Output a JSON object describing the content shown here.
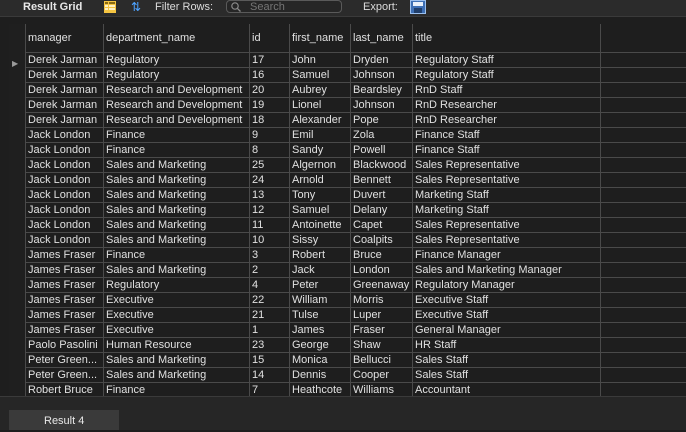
{
  "toolbar": {
    "title": "Result Grid",
    "filter_label": "Filter Rows:",
    "search_placeholder": "Search",
    "export_label": "Export:"
  },
  "grid": {
    "columns": [
      "manager",
      "department_name",
      "id",
      "first_name",
      "last_name",
      "title"
    ],
    "rows": [
      [
        "Derek Jarman",
        "Regulatory",
        "17",
        "John",
        "Dryden",
        "Regulatory Staff"
      ],
      [
        "Derek Jarman",
        "Regulatory",
        "16",
        "Samuel",
        "Johnson",
        "Regulatory Staff"
      ],
      [
        "Derek Jarman",
        "Research and Development",
        "20",
        "Aubrey",
        "Beardsley",
        "RnD Staff"
      ],
      [
        "Derek Jarman",
        "Research and Development",
        "19",
        "Lionel",
        "Johnson",
        "RnD Researcher"
      ],
      [
        "Derek Jarman",
        "Research and Development",
        "18",
        "Alexander",
        "Pope",
        "RnD Researcher"
      ],
      [
        "Jack London",
        "Finance",
        "9",
        "Emil",
        "Zola",
        "Finance Staff"
      ],
      [
        "Jack London",
        "Finance",
        "8",
        "Sandy",
        "Powell",
        "Finance Staff"
      ],
      [
        "Jack London",
        "Sales and Marketing",
        "25",
        "Algernon",
        "Blackwood",
        "Sales Representative"
      ],
      [
        "Jack London",
        "Sales and Marketing",
        "24",
        "Arnold",
        "Bennett",
        "Sales Representative"
      ],
      [
        "Jack London",
        "Sales and Marketing",
        "13",
        "Tony",
        "Duvert",
        "Marketing Staff"
      ],
      [
        "Jack London",
        "Sales and Marketing",
        "12",
        "Samuel",
        "Delany",
        "Marketing Staff"
      ],
      [
        "Jack London",
        "Sales and Marketing",
        "11",
        "Antoinette",
        "Capet",
        "Sales Representative"
      ],
      [
        "Jack London",
        "Sales and Marketing",
        "10",
        "Sissy",
        "Coalpits",
        "Sales Representative"
      ],
      [
        "James Fraser",
        "Finance",
        "3",
        "Robert",
        "Bruce",
        "Finance Manager"
      ],
      [
        "James Fraser",
        "Sales and Marketing",
        "2",
        "Jack",
        "London",
        "Sales and Marketing Manager"
      ],
      [
        "James Fraser",
        "Regulatory",
        "4",
        "Peter",
        "Greenaway",
        "Regulatory Manager"
      ],
      [
        "James Fraser",
        "Executive",
        "22",
        "William",
        "Morris",
        "Executive Staff"
      ],
      [
        "James Fraser",
        "Executive",
        "21",
        "Tulse",
        "Luper",
        "Executive Staff"
      ],
      [
        "James Fraser",
        "Executive",
        "1",
        "James",
        "Fraser",
        "General Manager"
      ],
      [
        "Paolo Pasolini",
        "Human Resource",
        "23",
        "George",
        "Shaw",
        "HR Staff"
      ],
      [
        "Peter Green...",
        "Sales and Marketing",
        "15",
        "Monica",
        "Bellucci",
        "Sales Staff"
      ],
      [
        "Peter Green...",
        "Sales and Marketing",
        "14",
        "Dennis",
        "Cooper",
        "Sales Staff"
      ],
      [
        "Robert Bruce",
        "Finance",
        "7",
        "Heathcote",
        "Williams",
        "Accountant"
      ]
    ]
  },
  "bottom": {
    "tab_label": "Result 4"
  }
}
